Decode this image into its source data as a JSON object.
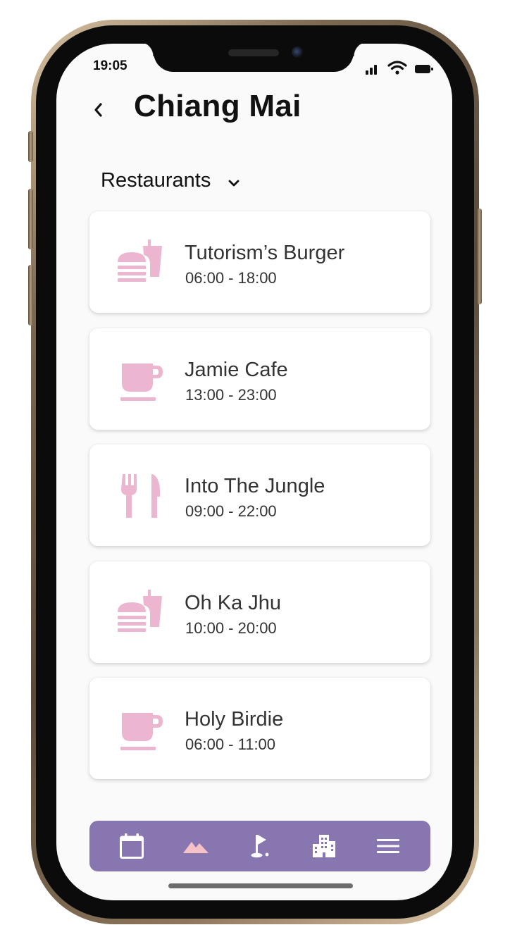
{
  "status_bar": {
    "time": "19:05"
  },
  "header": {
    "title": "Chiang Mai",
    "back_icon": "chevron-left-icon"
  },
  "category": {
    "selected": "Restaurants",
    "icon": "chevron-down-icon"
  },
  "places": [
    {
      "name": "Tutorism’s Burger",
      "hours": "06:00 - 18:00",
      "icon": "fast-food-icon"
    },
    {
      "name": "Jamie Cafe",
      "hours": "13:00 - 23:00",
      "icon": "coffee-cup-icon"
    },
    {
      "name": "Into The Jungle",
      "hours": "09:00 - 22:00",
      "icon": "fork-knife-icon"
    },
    {
      "name": "Oh Ka Jhu",
      "hours": "10:00 - 20:00",
      "icon": "fast-food-icon"
    },
    {
      "name": "Holy Birdie",
      "hours": "06:00 - 11:00",
      "icon": "coffee-cup-icon"
    }
  ],
  "bottom_nav": {
    "items": [
      {
        "icon": "calendar-icon"
      },
      {
        "icon": "mountain-icon",
        "active": true
      },
      {
        "icon": "golf-icon"
      },
      {
        "icon": "city-icon"
      },
      {
        "icon": "menu-icon"
      }
    ]
  },
  "colors": {
    "accent": "#8876b0",
    "icon_pink": "#edb6d0",
    "active_nav_icon": "#f6c2c8",
    "text": "#333333"
  }
}
